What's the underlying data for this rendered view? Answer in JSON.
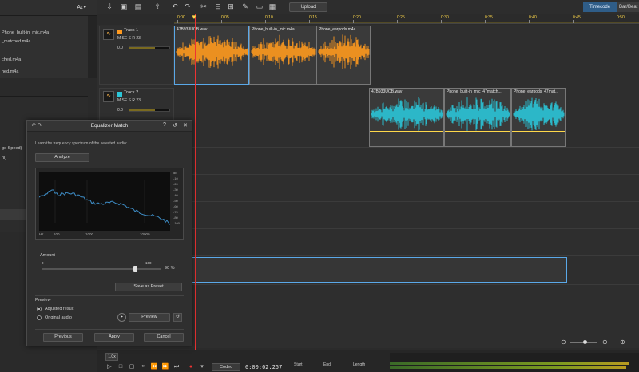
{
  "left_panel": {
    "font_button": "A↕▾",
    "files": [
      "Phone_built-in_mic.m4a",
      "_matched.m4a",
      "",
      "ched.m4a",
      "hed.m4a"
    ],
    "items": [
      "ge Speed)",
      "ni)"
    ]
  },
  "toolbar": {
    "upload": "Upload",
    "timecode": "Timecode",
    "bar_beat": "Bar/Beat"
  },
  "ruler": {
    "labels": [
      "0:00",
      "0:05",
      "0:10",
      "0:15",
      "0:20",
      "0:25",
      "0:30",
      "0:35",
      "0:40",
      "0:45",
      "0:50"
    ]
  },
  "tracks": [
    {
      "name": "Track 1",
      "controls": "M   SE   S   R   23",
      "vol": "0.0",
      "color": "#ff9a1f",
      "clips": [
        "47B933UOB.wav",
        "Phone_built-in_mic.m4a",
        "Phone_earpods.m4a"
      ]
    },
    {
      "name": "Track 2",
      "controls": "M   SE   S   R   23",
      "vol": "0.0",
      "color": "#2bc6d8",
      "clips": [
        "47B933UOB.wav",
        "Phone_built-in_mic_47match...",
        "Phone_earpods_47mat..."
      ]
    }
  ],
  "dialog": {
    "title": "Equalizer Match",
    "undo_label": "↶ ↷",
    "help": "?",
    "reset": "↺",
    "close": "✕",
    "description": "Learn the frequency spectrum of the selected audio:",
    "analyze": "Analyze",
    "x_ticks": [
      "Hz",
      "100",
      "1000",
      "10000"
    ],
    "y_ticks": [
      "dB",
      "-10",
      "-20",
      "-30",
      "-40",
      "-50",
      "-60",
      "-70",
      "-80",
      "-100"
    ],
    "amount_label": "Amount",
    "amount_min": "0",
    "amount_max": "100",
    "amount_value": "90 %",
    "amount_fraction": 0.9,
    "save_preset": "Save as Preset",
    "preview_label": "Preview",
    "adjusted": "Adjusted result",
    "original": "Original audio",
    "preview_btn": "Preview",
    "previous": "Previous",
    "apply": "Apply",
    "cancel": "Cancel"
  },
  "bottom": {
    "zoom": "1.0x",
    "codec": "Codec",
    "timecode": "0:00:02.257",
    "start": "Start",
    "end": "End",
    "length": "Length"
  },
  "colors": {
    "orange_wave": "#ff9a1f",
    "cyan_wave": "#2bc6d8",
    "playhead": "#ee3333",
    "selection": "#5aa8e8",
    "accent": "#2f5d88"
  },
  "icons": {
    "play": "play-icon",
    "stop": "stop-icon",
    "record": "record-icon",
    "loop": "loop-icon"
  }
}
